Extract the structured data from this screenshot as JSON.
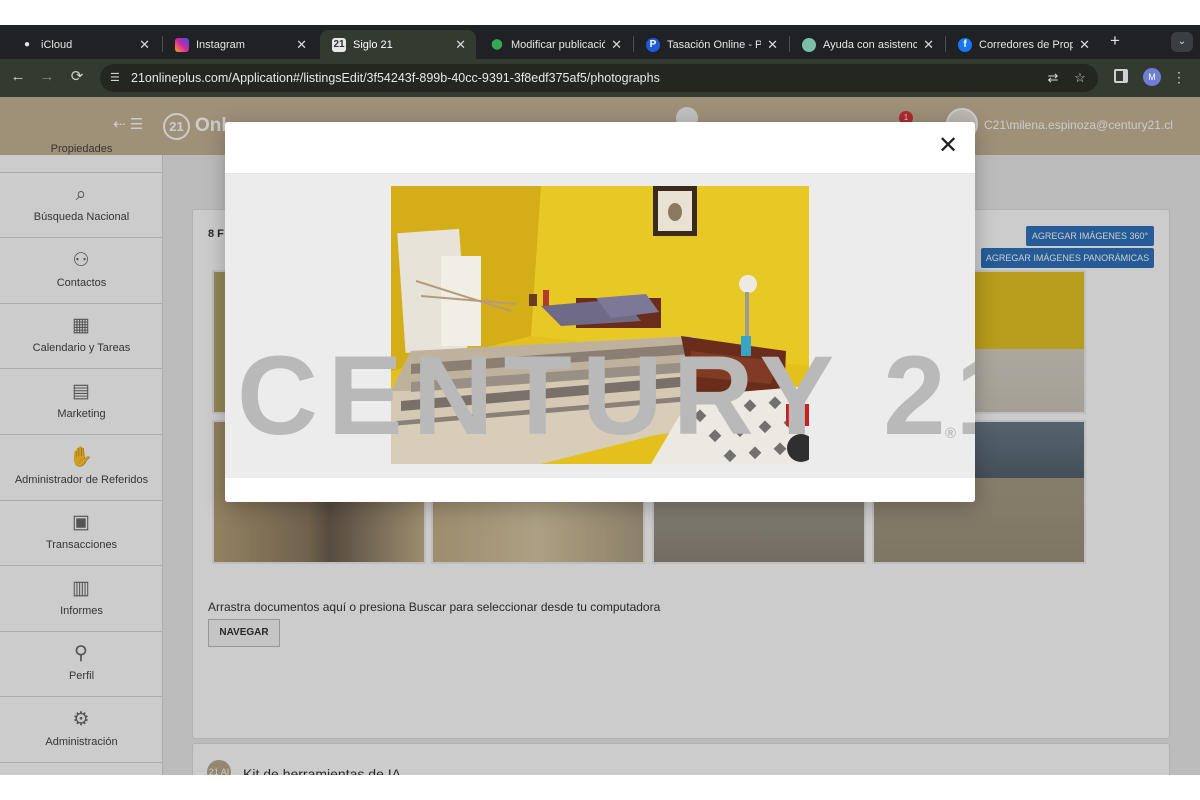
{
  "browser": {
    "tabs": [
      {
        "title": "iCloud",
        "icon_text": "",
        "active": false
      },
      {
        "title": "Instagram",
        "icon_text": "",
        "active": false
      },
      {
        "title": "Siglo 21",
        "icon_text": "21",
        "active": true
      },
      {
        "title": "Modificar publicació",
        "icon_text": "",
        "active": false
      },
      {
        "title": "Tasación Online - Pr",
        "icon_text": "P",
        "active": false
      },
      {
        "title": "Ayuda con asistenci",
        "icon_text": "",
        "active": false
      },
      {
        "title": "Corredores de Propi",
        "icon_text": "f",
        "active": false
      }
    ],
    "tab_close": "✕",
    "new_tab": "+",
    "url": "21onlineplus.com/Application#/listingsEdit/3f54243f-899b-40cc-9391-3f8edf375af5/photographs",
    "profile_initial": "M"
  },
  "app": {
    "logo_ring": "21",
    "logo_name": "Onl",
    "notification_count": "1",
    "user": "C21\\milena.espinoza@century21.cl"
  },
  "sidebar": {
    "items": [
      {
        "label": "Propiedades",
        "icon": "house-icon"
      },
      {
        "label": "Búsqueda Nacional",
        "icon": "search-icon"
      },
      {
        "label": "Contactos",
        "icon": "contacts-icon"
      },
      {
        "label": "Calendario y Tareas",
        "icon": "calendar-icon"
      },
      {
        "label": "Marketing",
        "icon": "book-icon"
      },
      {
        "label": "Administrador de Referidos",
        "icon": "handshake-icon"
      },
      {
        "label": "Transacciones",
        "icon": "briefcase-icon"
      },
      {
        "label": "Informes",
        "icon": "bar-chart-icon"
      },
      {
        "label": "Perfil",
        "icon": "user-icon"
      },
      {
        "label": "Administración",
        "icon": "gear-icon"
      }
    ]
  },
  "listing": {
    "photos_count_label": "8 F",
    "btn_360": "AGREGAR IMÁGENES 360°",
    "btn_panoramic": "AGREGAR IMÁGENES PANORÁMICAS",
    "drop_text": "Arrastra documentos aquí o presiona Buscar para seleccionar desde tu computadora",
    "browse_button": "NAVEGAR"
  },
  "ai_kit": {
    "icon_text": "21 AI",
    "title": "Kit de herramientas de IA."
  },
  "modal": {
    "close": "✕",
    "watermark": "CENTURY 21",
    "watermark_reg": "®"
  },
  "colors": {
    "accent": "#2f74bd",
    "header": "#c7b496",
    "wall": "#e4c21e"
  }
}
